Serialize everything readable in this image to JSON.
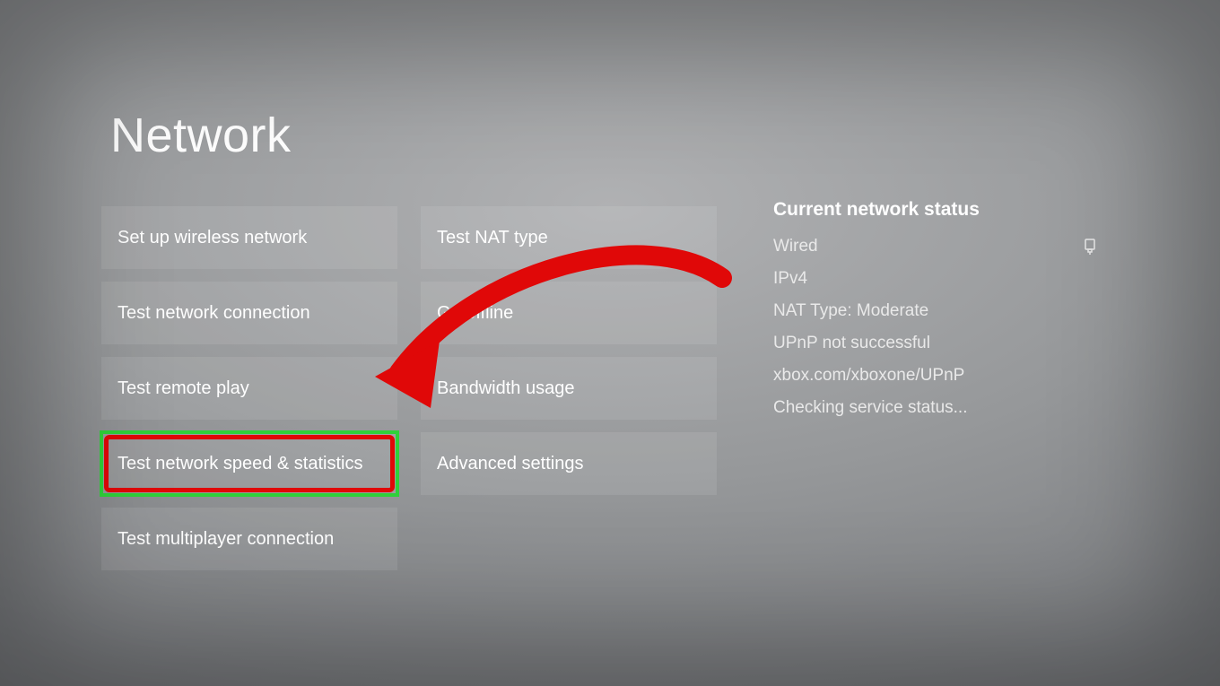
{
  "page": {
    "title": "Network"
  },
  "columns": {
    "left": [
      {
        "id": "setup-wireless",
        "label": "Set up wireless network",
        "highlighted": false
      },
      {
        "id": "test-connection",
        "label": "Test network connection",
        "highlighted": false
      },
      {
        "id": "test-remote-play",
        "label": "Test remote play",
        "highlighted": false
      },
      {
        "id": "test-speed",
        "label": "Test network speed & statistics",
        "highlighted": true
      },
      {
        "id": "test-multiplayer",
        "label": "Test multiplayer connection",
        "highlighted": false
      }
    ],
    "right": [
      {
        "id": "test-nat",
        "label": "Test NAT type",
        "highlighted": false
      },
      {
        "id": "go-offline",
        "label": "Go offline",
        "highlighted": false
      },
      {
        "id": "bandwidth",
        "label": "Bandwidth usage",
        "highlighted": false
      },
      {
        "id": "advanced",
        "label": "Advanced settings",
        "highlighted": false
      }
    ]
  },
  "status": {
    "heading": "Current network status",
    "connection_type": "Wired",
    "ip_version": "IPv4",
    "nat_type": "NAT Type: Moderate",
    "upnp": "UPnP not successful",
    "help_url": "xbox.com/xboxone/UPnP",
    "service": "Checking service status..."
  },
  "annotation": {
    "arrow_color": "#e00808",
    "highlight_outer": "#2fd13a",
    "highlight_inner": "#e00808"
  }
}
